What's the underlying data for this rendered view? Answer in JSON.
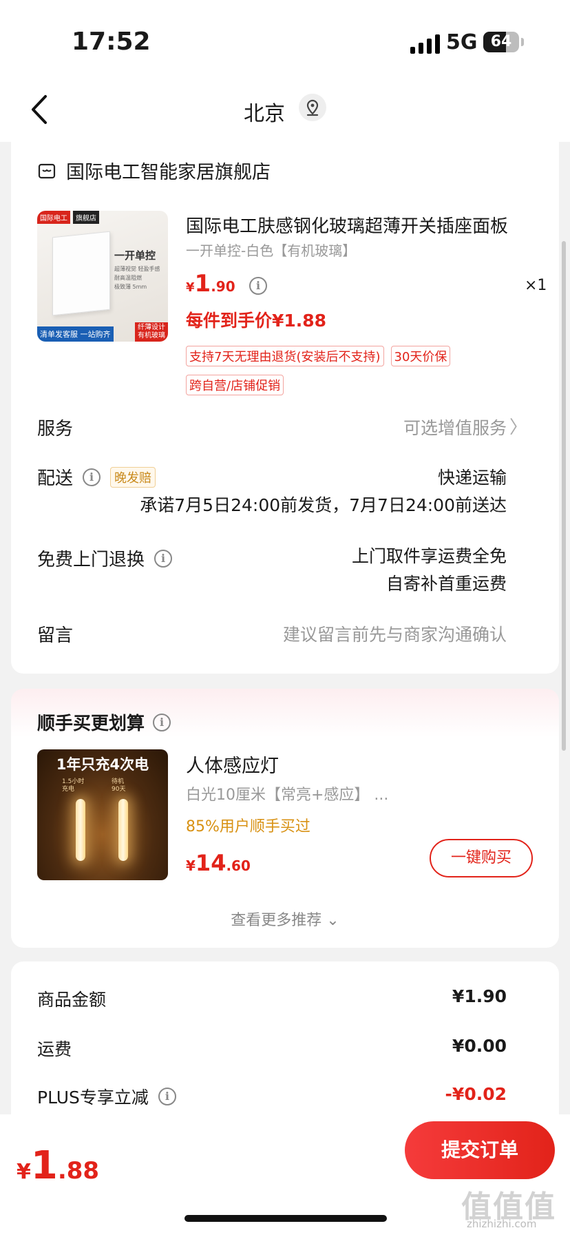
{
  "status_bar": {
    "time": "17:52",
    "network": "5G",
    "battery": "64",
    "battery_level": 0.64
  },
  "nav": {
    "title": "北京"
  },
  "order": {
    "store_name": "国际电工智能家居旗舰店",
    "product": {
      "image_badges": {
        "brand": "国际电工",
        "store_tag": "旗舰店",
        "headline": "一开单控",
        "features": [
          "超薄视觉 轻盈手感",
          "耐高温阻燃",
          "极致薄 5mm"
        ],
        "banner_left": "清单发客服 一站购齐",
        "banner_right_1": "纤薄设计",
        "banner_right_2": "有机玻璃"
      },
      "title": "国际电工肤感钢化玻璃超薄开关插座面板",
      "spec": "一开单控-白色【有机玻璃】",
      "price_symbol": "¥",
      "price_int": "1",
      "price_dec": ".90",
      "quantity": "×1",
      "final_price": "每件到手价¥1.88",
      "tags": [
        "支持7天无理由退货(安装后不支持)",
        "30天价保",
        "跨自营/店铺促销"
      ]
    },
    "service": {
      "label": "服务",
      "value": "可选增值服务"
    },
    "delivery": {
      "label": "配送",
      "tag": "晚发赔",
      "method": "快递运输",
      "promise": "承诺7月5日24:00前发货，7月7日24:00前送达"
    },
    "return": {
      "label": "免费上门退换",
      "line1": "上门取件享运费全免",
      "line2": "自寄补首重运费"
    },
    "message": {
      "label": "留言",
      "placeholder": "建议留言前先与商家沟通确认"
    }
  },
  "recommend": {
    "title": "顺手买更划算",
    "image_text": {
      "headline": "1年只充4次电",
      "left_top": "1.5小时",
      "left_bottom": "充电",
      "right_top": "待机",
      "right_bottom": "90天"
    },
    "name": "人体感应灯",
    "spec": "白光10厘米【常亮+感应】 ...",
    "bought": "85%用户顺手买过",
    "price_symbol": "¥",
    "price_int": "14",
    "price_dec": ".60",
    "buy_label": "一键购买",
    "more_label": "查看更多推荐 ⌄"
  },
  "summary": {
    "rows": [
      {
        "label": "商品金额",
        "value": "¥1.90"
      },
      {
        "label": "运费",
        "value": "¥0.00"
      },
      {
        "label": "PLUS专享立减",
        "value": "-¥0.02"
      }
    ]
  },
  "bottom": {
    "total_symbol": "¥",
    "total_int": "1",
    "total_dec": ".88",
    "submit_label": "提交订单",
    "watermark": "值值值",
    "watermark_sub": "zhizhizhi.com"
  },
  "colors": {
    "accent": "#e2231a",
    "bought": "#d89113",
    "late_tag": "#c98a1c"
  }
}
